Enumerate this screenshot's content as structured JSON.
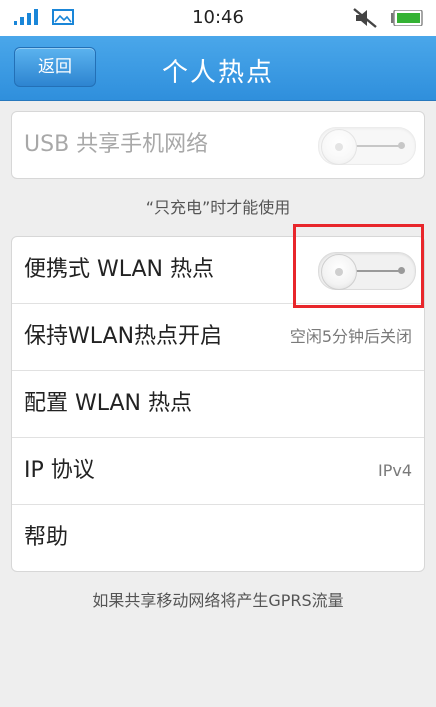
{
  "status_bar": {
    "time": "10:46",
    "icons": [
      "signal-icon",
      "picture-icon",
      "mute-icon",
      "battery-icon"
    ],
    "signal_color": "#1a86d8",
    "battery_color": "#34b233"
  },
  "header": {
    "back_label": "返回",
    "title": "个人热点",
    "accent_color": "#3b9be3"
  },
  "usb_section": {
    "label": "USB 共享手机网络",
    "toggle_on": false,
    "enabled": false,
    "note": "“只充电”时才能使用"
  },
  "wlan_section": {
    "rows": [
      {
        "label": "便携式 WLAN 热点",
        "type": "toggle",
        "toggle_on": false
      },
      {
        "label": "保持WLAN热点开启",
        "value": "空闲5分钟后关闭"
      },
      {
        "label": "配置 WLAN 热点"
      },
      {
        "label": "IP 协议",
        "value": "IPv4"
      },
      {
        "label": "帮助"
      }
    ]
  },
  "footer_note": "如果共享移动网络将产生GPRS流量",
  "highlight_color": "#e8262b"
}
